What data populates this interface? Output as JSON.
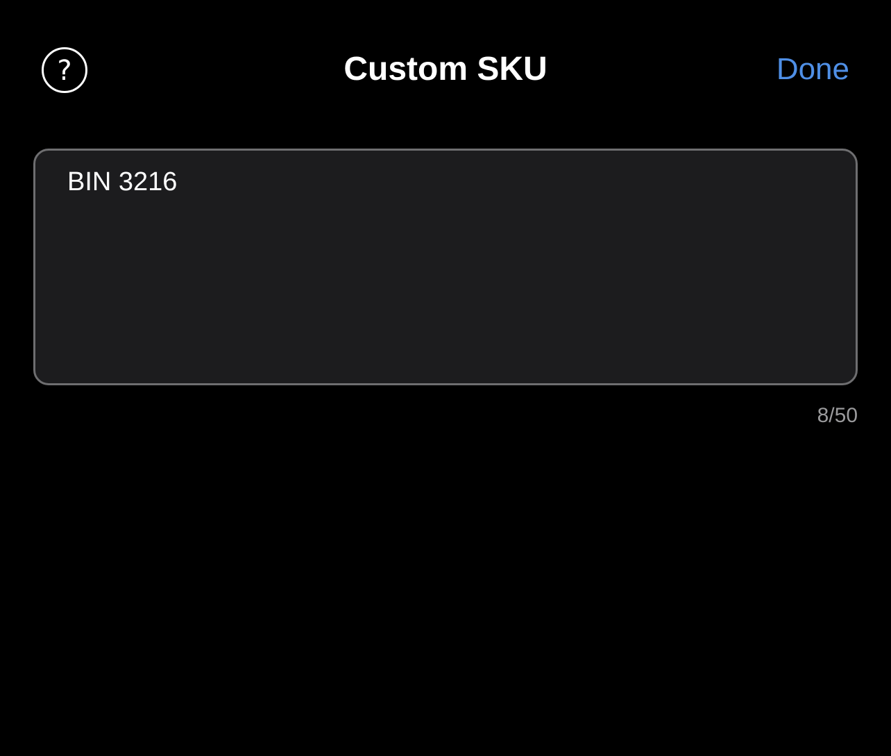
{
  "header": {
    "title": "Custom SKU",
    "help_label": "?",
    "done_label": "Done"
  },
  "sku_field": {
    "value": "BIN 3216",
    "char_count": "8/50"
  },
  "colors": {
    "background": "#000000",
    "field_background": "#1c1c1e",
    "field_border": "#6e6e70",
    "accent": "#4f8fe6",
    "counter_text": "#9a9a9c"
  },
  "icons": {
    "help": "question-mark-circle-icon"
  }
}
